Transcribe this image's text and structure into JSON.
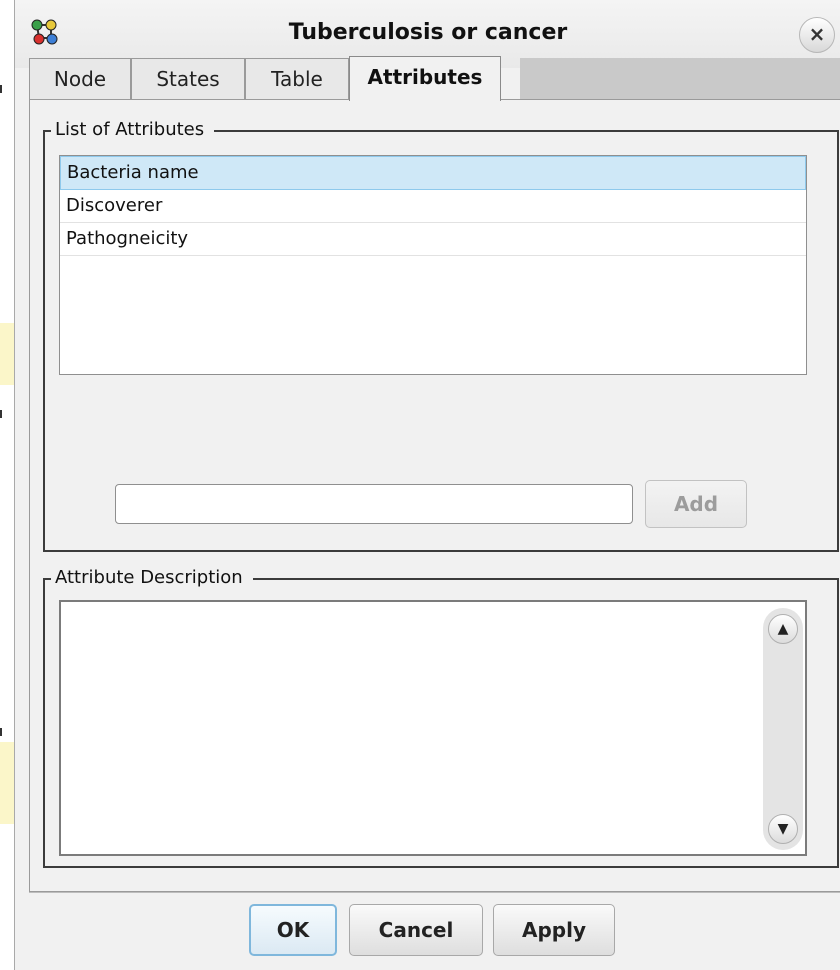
{
  "window": {
    "title": "Tuberculosis or cancer"
  },
  "icons": {
    "app": "network-nodes-icon",
    "close": "close-icon",
    "scroll_up": "scroll-up-icon",
    "scroll_down": "scroll-down-icon"
  },
  "tabs": [
    {
      "label": "Node"
    },
    {
      "label": "States"
    },
    {
      "label": "Table"
    },
    {
      "label": "Attributes"
    }
  ],
  "active_tab": "Attributes",
  "attributes_group": {
    "label": "List of Attributes",
    "items": [
      {
        "label": "Bacteria name",
        "selected": true
      },
      {
        "label": "Discoverer",
        "selected": false
      },
      {
        "label": "Pathogneicity",
        "selected": false
      }
    ],
    "new_attribute_value": "",
    "add_label": "Add"
  },
  "description_group": {
    "label": "Attribute Description",
    "text": ""
  },
  "footer": {
    "ok_label": "OK",
    "cancel_label": "Cancel",
    "apply_label": "Apply"
  },
  "close_symbol": "×",
  "scroll_up_symbol": "▲",
  "scroll_down_symbol": "▼"
}
